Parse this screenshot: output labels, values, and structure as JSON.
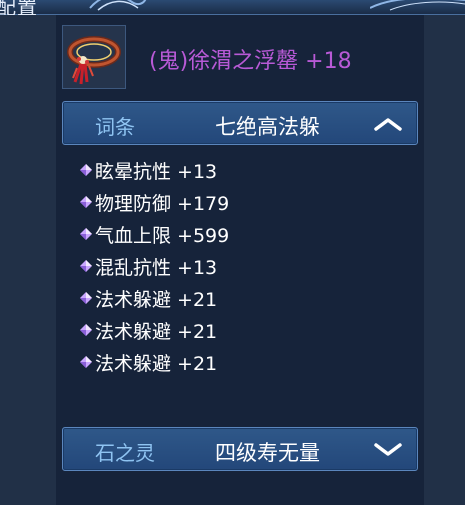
{
  "window": {
    "title": "配置"
  },
  "item": {
    "icon": "gem-necklace-icon",
    "name": "(鬼)徐渭之浮罄 +18",
    "name_color": "#b85ad6"
  },
  "affix_section": {
    "label": "词条",
    "value": "七绝高法躲",
    "expanded": true
  },
  "attributes": [
    {
      "text": "眩晕抗性 +13"
    },
    {
      "text": "物理防御 +179"
    },
    {
      "text": "气血上限 +599"
    },
    {
      "text": "混乱抗性 +13"
    },
    {
      "text": "法术躲避 +21"
    },
    {
      "text": "法术躲避 +21"
    },
    {
      "text": "法术躲避 +21"
    }
  ],
  "soul_section": {
    "label": "石之灵",
    "value": "四级寿无量",
    "expanded": false
  },
  "colors": {
    "background": "#16233a",
    "bar_label": "#8fc4f2",
    "attribute_bullet": "#c9a6ff"
  }
}
